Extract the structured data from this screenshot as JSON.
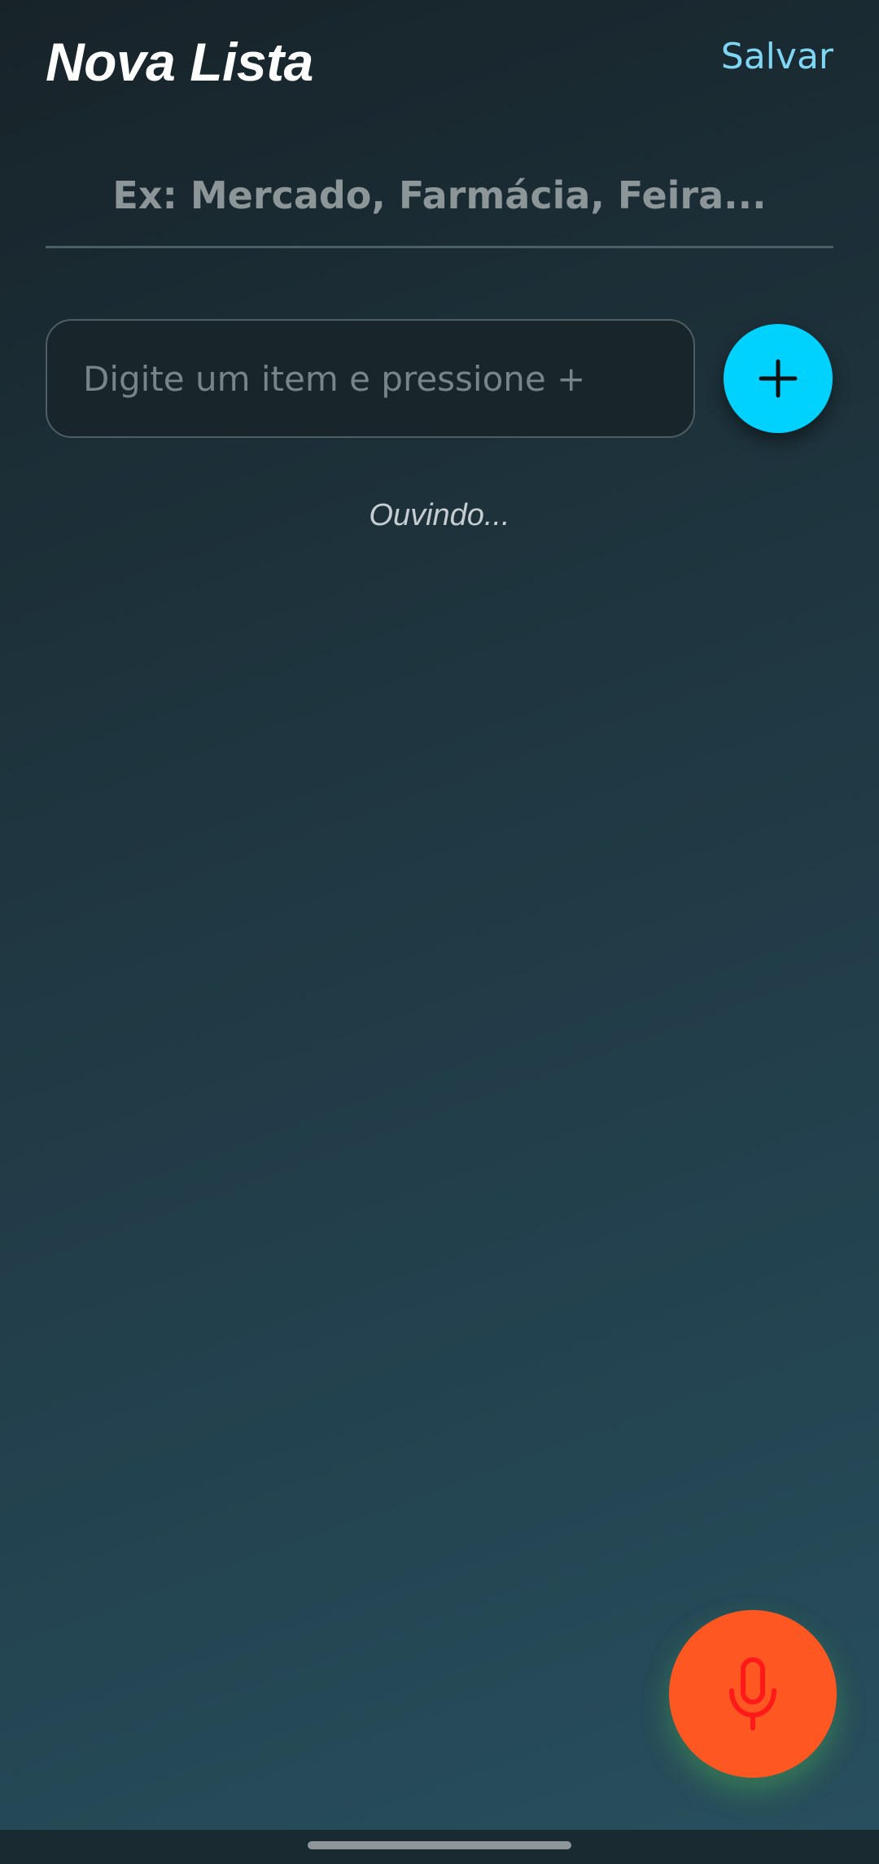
{
  "header": {
    "title": "Nova Lista",
    "save_label": "Salvar"
  },
  "list_name": {
    "value": "",
    "placeholder": "Ex: Mercado, Farmácia, Feira..."
  },
  "item_entry": {
    "value": "",
    "placeholder": "Digite um item e pressione +"
  },
  "status": {
    "text": "Ouvindo..."
  },
  "icons": {
    "add": "plus-icon",
    "mic": "microphone-icon"
  },
  "colors": {
    "accent": "#00d2ff",
    "save_link": "#7fd6f4",
    "mic_button": "#ff5722",
    "mic_icon": "#ff1a1a"
  }
}
